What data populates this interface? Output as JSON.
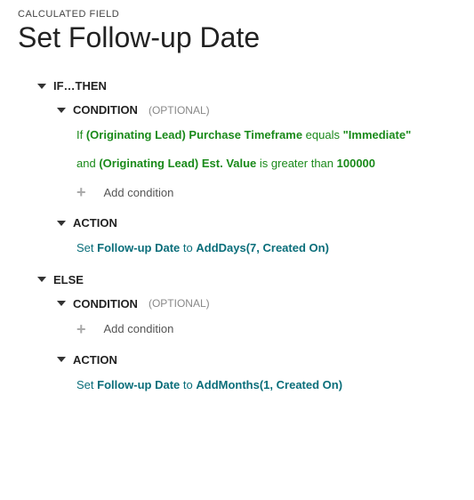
{
  "header_label": "CALCULATED FIELD",
  "title": "Set Follow-up Date",
  "ifthen": {
    "label": "IF…THEN",
    "condition": {
      "label": "CONDITION",
      "optional": "(OPTIONAL)",
      "line1": {
        "prefix": "If ",
        "field": "(Originating Lead) Purchase Timeframe",
        "op": " equals ",
        "value": "\"Immediate\""
      },
      "line2": {
        "prefix": "and ",
        "field": "(Originating Lead) Est. Value",
        "op": " is greater than ",
        "value": "100000"
      },
      "add": "Add condition"
    },
    "action": {
      "label": "ACTION",
      "prefix": "Set ",
      "field": "Follow-up Date",
      "to": " to ",
      "func": "AddDays(7, Created On)"
    }
  },
  "else": {
    "label": "ELSE",
    "condition": {
      "label": "CONDITION",
      "optional": "(OPTIONAL)",
      "add": "Add condition"
    },
    "action": {
      "label": "ACTION",
      "prefix": "Set ",
      "field": "Follow-up Date",
      "to": " to ",
      "func": "AddMonths(1, Created On)"
    }
  }
}
